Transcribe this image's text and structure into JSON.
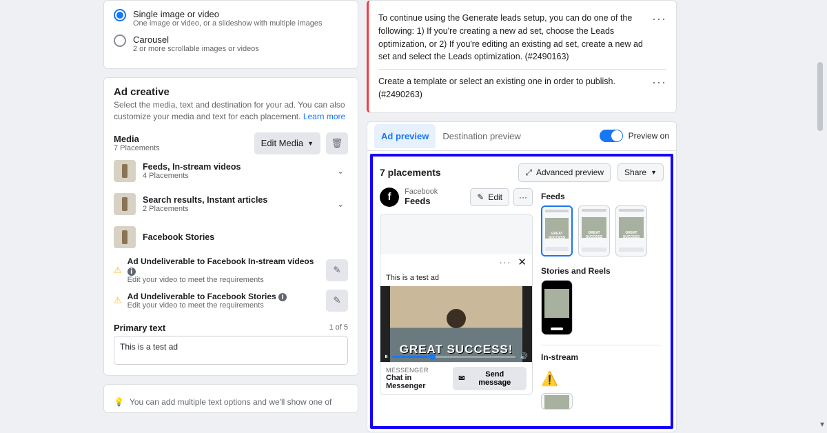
{
  "left": {
    "format": {
      "single": {
        "title": "Single image or video",
        "sub": "One image or video, or a slideshow with multiple images"
      },
      "carousel": {
        "title": "Carousel",
        "sub": "2 or more scrollable images or videos"
      }
    },
    "creative": {
      "title": "Ad creative",
      "desc_a": "Select the media, text and destination for your ad. You can also customize your media and text for each placement. ",
      "learn": "Learn more"
    },
    "media": {
      "label": "Media",
      "sub": "7 Placements",
      "edit": "Edit Media"
    },
    "pl1": {
      "title": "Feeds, In-stream videos",
      "sub": "4 Placements"
    },
    "pl2": {
      "title": "Search results, Instant articles",
      "sub": "2 Placements"
    },
    "pl3": {
      "title": "Facebook Stories"
    },
    "warn1": {
      "title": "Ad Undeliverable to Facebook In-stream videos",
      "sub": "Edit your video to meet the requirements"
    },
    "warn2": {
      "title": "Ad Undeliverable to Facebook Stories",
      "sub": "Edit your video to meet the requirements"
    },
    "primary": {
      "label": "Primary text",
      "count": "1 of 5",
      "value": "This is a test ad"
    },
    "hint": "You can add multiple text options and we'll show one of"
  },
  "right": {
    "alert1": "To continue using the Generate leads setup, you can do one of the following: 1) If you're creating a new ad set, choose the Leads optimization, or 2) If you're editing an existing ad set, create a new ad set and select the Leads optimization. (#2490163)",
    "alert2": "Create a template or select an existing one in order to publish. (#2490263)",
    "tabs": {
      "preview": "Ad preview",
      "dest": "Destination preview",
      "toggle": "Preview on"
    },
    "blue": {
      "title": "7 placements",
      "adv": "Advanced preview",
      "share": "Share",
      "fb_small": "Facebook",
      "fb_big": "Feeds",
      "edit": "Edit",
      "post_text": "This is a test ad",
      "caption": "GREAT SUCCESS!",
      "msg_small": "MESSENGER",
      "msg_big": "Chat in Messenger",
      "send": "Send message",
      "grp_feeds": "Feeds",
      "grp_stories": "Stories and Reels",
      "grp_instream": "In-stream",
      "thumb_cap": "GREAT SUCCESS"
    }
  }
}
